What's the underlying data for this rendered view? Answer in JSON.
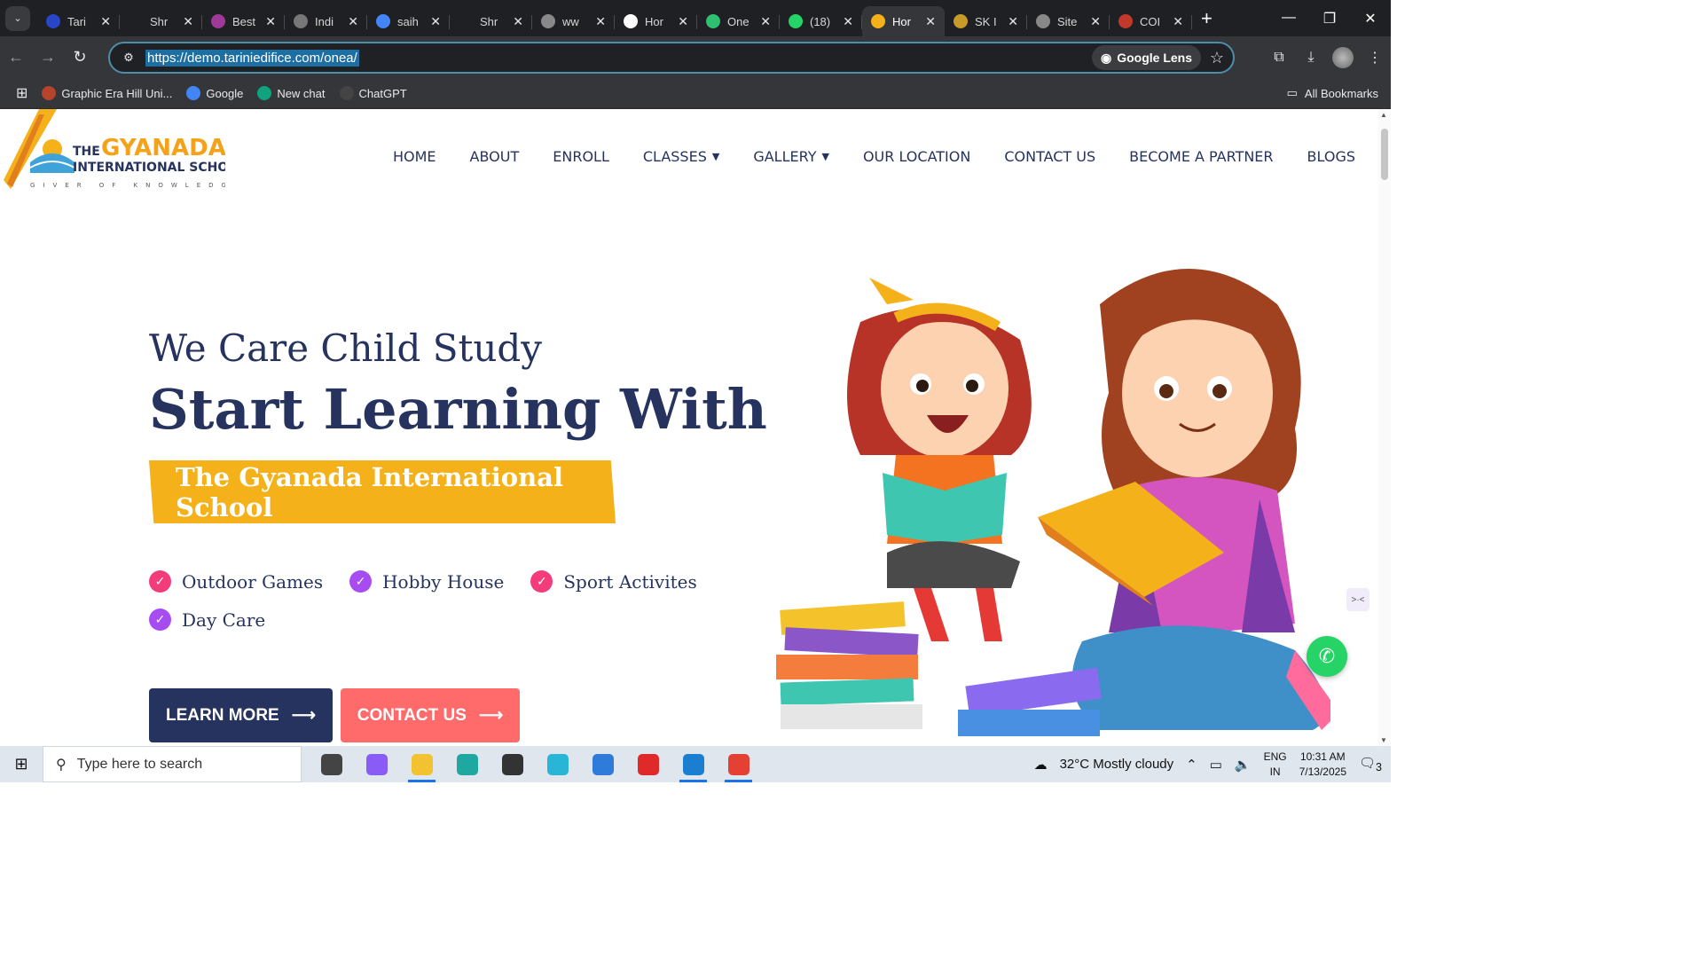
{
  "browser": {
    "tabs": [
      {
        "title": "Tari",
        "color": "#2946c7"
      },
      {
        "title": "Shr",
        "color": "#1f2023"
      },
      {
        "title": "Best",
        "color": "#a03a9a"
      },
      {
        "title": "Indi",
        "color": "#777777"
      },
      {
        "title": "saih",
        "color": "#4285f4"
      },
      {
        "title": "Shr",
        "color": "#1f2023"
      },
      {
        "title": "ww",
        "color": "#888888"
      },
      {
        "title": "Hor",
        "color": "#ffffff"
      },
      {
        "title": "One",
        "color": "#2fbf71"
      },
      {
        "title": "(18)",
        "color": "#25d366"
      },
      {
        "title": "Hor",
        "color": "#f4b11a"
      },
      {
        "title": "SK I",
        "color": "#c79a2a"
      },
      {
        "title": "Site",
        "color": "#888888"
      },
      {
        "title": "COI",
        "color": "#c0392b"
      }
    ],
    "url": "https://demo.tariniedifice.com/onea/",
    "lens_label": "Google Lens",
    "bookmarks": [
      {
        "label": "Graphic Era Hill Uni...",
        "color": "#b5442b"
      },
      {
        "label": "Google",
        "color": "#4285f4"
      },
      {
        "label": "New chat",
        "color": "#10a37f"
      },
      {
        "label": "ChatGPT",
        "color": "#444444"
      }
    ],
    "all_bookmarks": "All Bookmarks"
  },
  "site": {
    "logo": {
      "line1": "THE",
      "line2": "GYANADA",
      "line3": "INTERNATIONAL SCHOOL",
      "tagline": "GIVER OF KNOWLEDGE"
    },
    "nav": [
      {
        "label": "HOME",
        "dropdown": false
      },
      {
        "label": "ABOUT",
        "dropdown": false
      },
      {
        "label": "ENROLL",
        "dropdown": false
      },
      {
        "label": "CLASSES",
        "dropdown": true
      },
      {
        "label": "GALLERY",
        "dropdown": true
      },
      {
        "label": "OUR LOCATION",
        "dropdown": false
      },
      {
        "label": "CONTACT US",
        "dropdown": false
      },
      {
        "label": "BECOME A PARTNER",
        "dropdown": false
      },
      {
        "label": "BLOGS",
        "dropdown": false
      }
    ],
    "hero": {
      "subtitle": "We Care Child Study",
      "title": "Start Learning With",
      "banner": "The Gyanada International School",
      "features": [
        {
          "label": "Outdoor Games",
          "color": "#f23d7a"
        },
        {
          "label": "Hobby House",
          "color": "#a64cf0"
        },
        {
          "label": "Sport Activites",
          "color": "#f23d7a"
        },
        {
          "label": "Day Care",
          "color": "#a64cf0"
        }
      ],
      "learn_more": "LEARN MORE",
      "contact_us": "CONTACT US"
    }
  },
  "taskbar": {
    "search_placeholder": "Type here to search",
    "weather": "32°C  Mostly cloudy",
    "lang1": "ENG",
    "lang2": "IN",
    "time": "10:31 AM",
    "date": "7/13/2025",
    "notifications": "3",
    "apps": [
      {
        "name": "task-view",
        "color": "#444444"
      },
      {
        "name": "copilot",
        "color": "#8a5cf6"
      },
      {
        "name": "file-explorer",
        "color": "#f2c230"
      },
      {
        "name": "edge",
        "color": "#1fa8a0"
      },
      {
        "name": "autodesk",
        "color": "#333333"
      },
      {
        "name": "app-3",
        "color": "#29b6d6"
      },
      {
        "name": "photos",
        "color": "#2f7bd9"
      },
      {
        "name": "wps",
        "color": "#e02a2a"
      },
      {
        "name": "vscode",
        "color": "#1b7fd1"
      },
      {
        "name": "chrome",
        "color": "#e44134"
      }
    ]
  }
}
